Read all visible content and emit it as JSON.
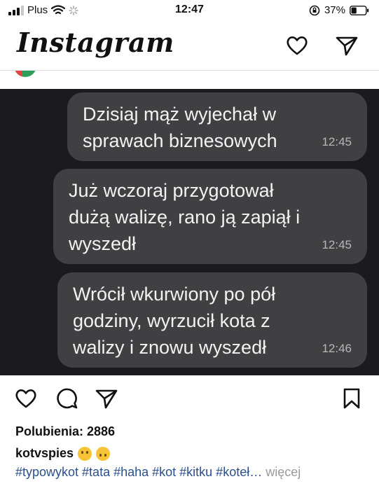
{
  "status_bar": {
    "carrier": "Plus",
    "time": "12:47",
    "battery": "37%",
    "battery_level": 0.37
  },
  "header": {
    "app_name": "Instagram"
  },
  "post_image": {
    "messages": [
      {
        "text_lines": [
          "Dzisiaj mąż wyjechał w",
          "sprawach biznesowych"
        ],
        "time": "12:45"
      },
      {
        "text_lines": [
          "Już wczoraj przygotował",
          "dużą walizę, rano ją zapiął i",
          "wyszedł"
        ],
        "time": "12:45"
      },
      {
        "text_lines": [
          "Wrócił wkurwiony po pół",
          "godziny, wyrzucił kota z",
          "walizy i znowu wyszedł"
        ],
        "time": "12:46"
      }
    ]
  },
  "post": {
    "likes_label": "Polubienia: 2886",
    "username": "kotvspies",
    "caption_emojis": [
      "grinning-face",
      "upside-down-face"
    ],
    "hashtags": "#typowykot #tata #haha #kot #kitku #koteł…",
    "more_label": "więcej"
  },
  "colors": {
    "hashtag": "#2c4f8c",
    "bubble": "#404042",
    "image_bg": "#1b1b1d"
  }
}
